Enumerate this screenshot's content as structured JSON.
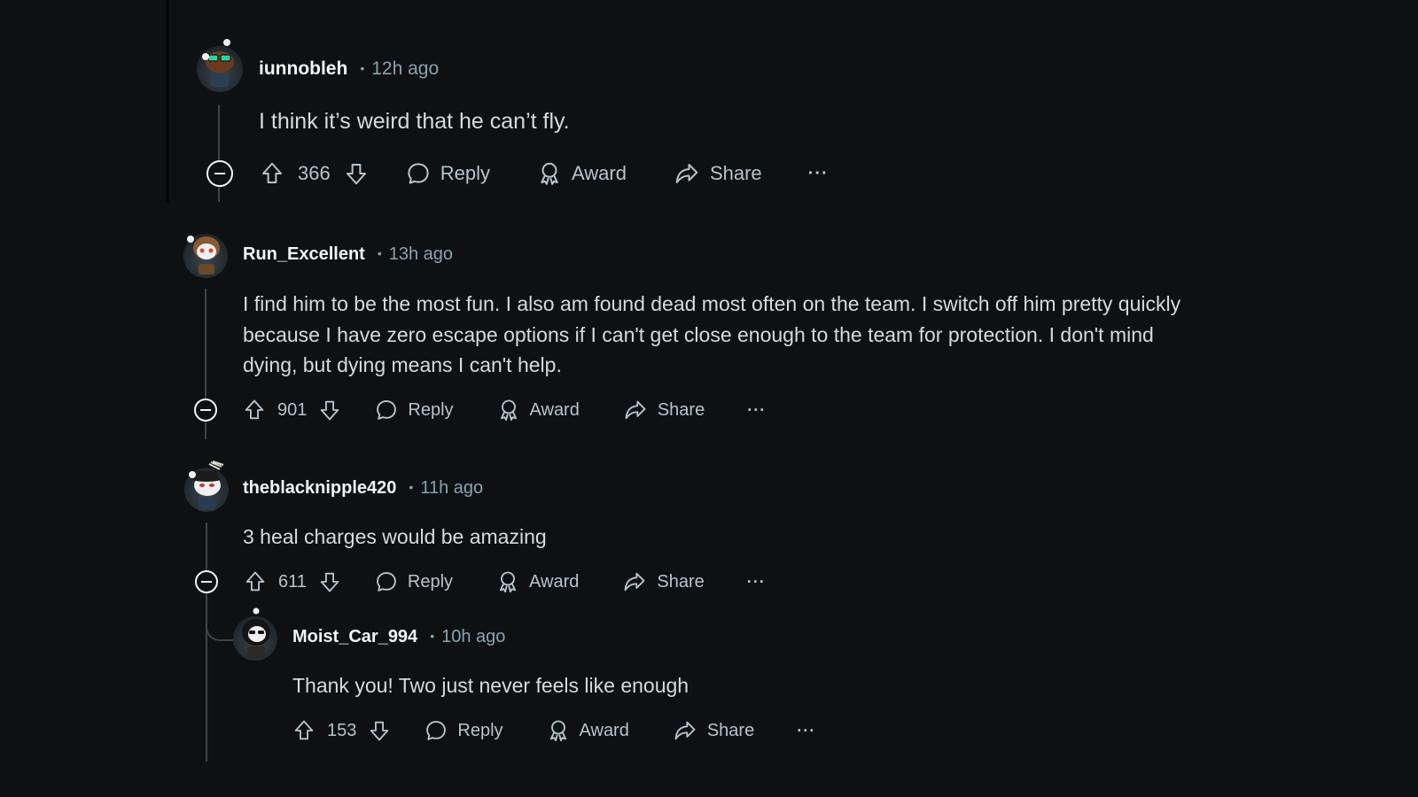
{
  "comments": [
    {
      "username": "iunnobleh",
      "separator": "•",
      "time": "12h ago",
      "body": "I think it’s weird that he can’t fly.",
      "score": "366",
      "actions": {
        "reply": "Reply",
        "award": "Award",
        "share": "Share",
        "more": "···"
      }
    },
    {
      "username": "Run_Excellent",
      "separator": "•",
      "time": "13h ago",
      "body": "I find him to be the most fun. I also am found dead most often on the team. I switch off him pretty quickly because I have zero escape options if I can't get close enough to the team for protection. I don't mind dying, but dying means I can't help.",
      "score": "901",
      "actions": {
        "reply": "Reply",
        "award": "Award",
        "share": "Share",
        "more": "···"
      }
    },
    {
      "username": "theblacknipple420",
      "separator": "•",
      "time": "11h ago",
      "body": "3 heal charges would be amazing",
      "score": "611",
      "actions": {
        "reply": "Reply",
        "award": "Award",
        "share": "Share",
        "more": "···"
      }
    },
    {
      "username": "Moist_Car_994",
      "separator": "•",
      "time": "10h ago",
      "body": "Thank you! Two just never feels like enough",
      "score": "153",
      "actions": {
        "reply": "Reply",
        "award": "Award",
        "share": "Share",
        "more": "···"
      }
    }
  ],
  "colors": {
    "background": "#0e1113",
    "username": "#f2f4f5",
    "meta": "#8ba2ad",
    "body": "#d7dadc",
    "action": "#b7c4cc",
    "thread_line": "#3e4549"
  }
}
